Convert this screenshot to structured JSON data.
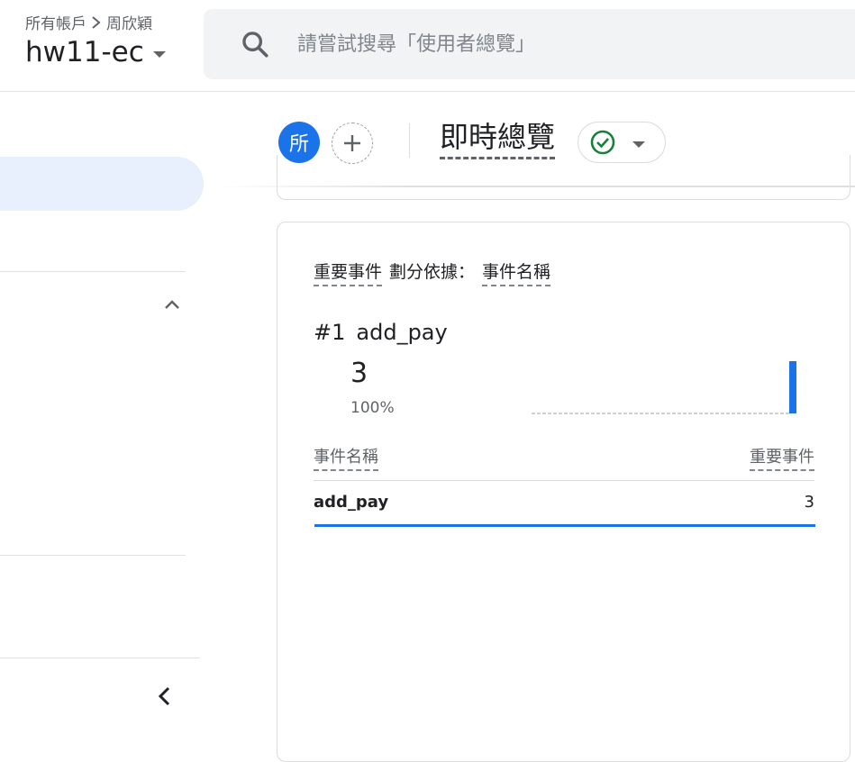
{
  "header": {
    "breadcrumb": {
      "root": "所有帳戶",
      "account": "周欣穎"
    },
    "property_name": "hw11-ec",
    "search_placeholder": "請嘗試搜尋「使用者總覽」"
  },
  "toolbar": {
    "avatar_letter": "所",
    "report_title": "即時總覽",
    "status_color": "#188038"
  },
  "card": {
    "header": {
      "metric": "重要事件",
      "split_label": "劃分依據：",
      "dimension": "事件名稱"
    },
    "top_item": {
      "rank": "#1",
      "name": "add_pay",
      "value": "3",
      "percent": "100%"
    },
    "sparkline": {
      "last_bar_value": 3,
      "bar_count": 30,
      "accent_color": "#1a73e8"
    },
    "table": {
      "columns": [
        "事件名稱",
        "重要事件"
      ],
      "rows": [
        {
          "name": "add_pay",
          "value": "3"
        }
      ]
    }
  }
}
